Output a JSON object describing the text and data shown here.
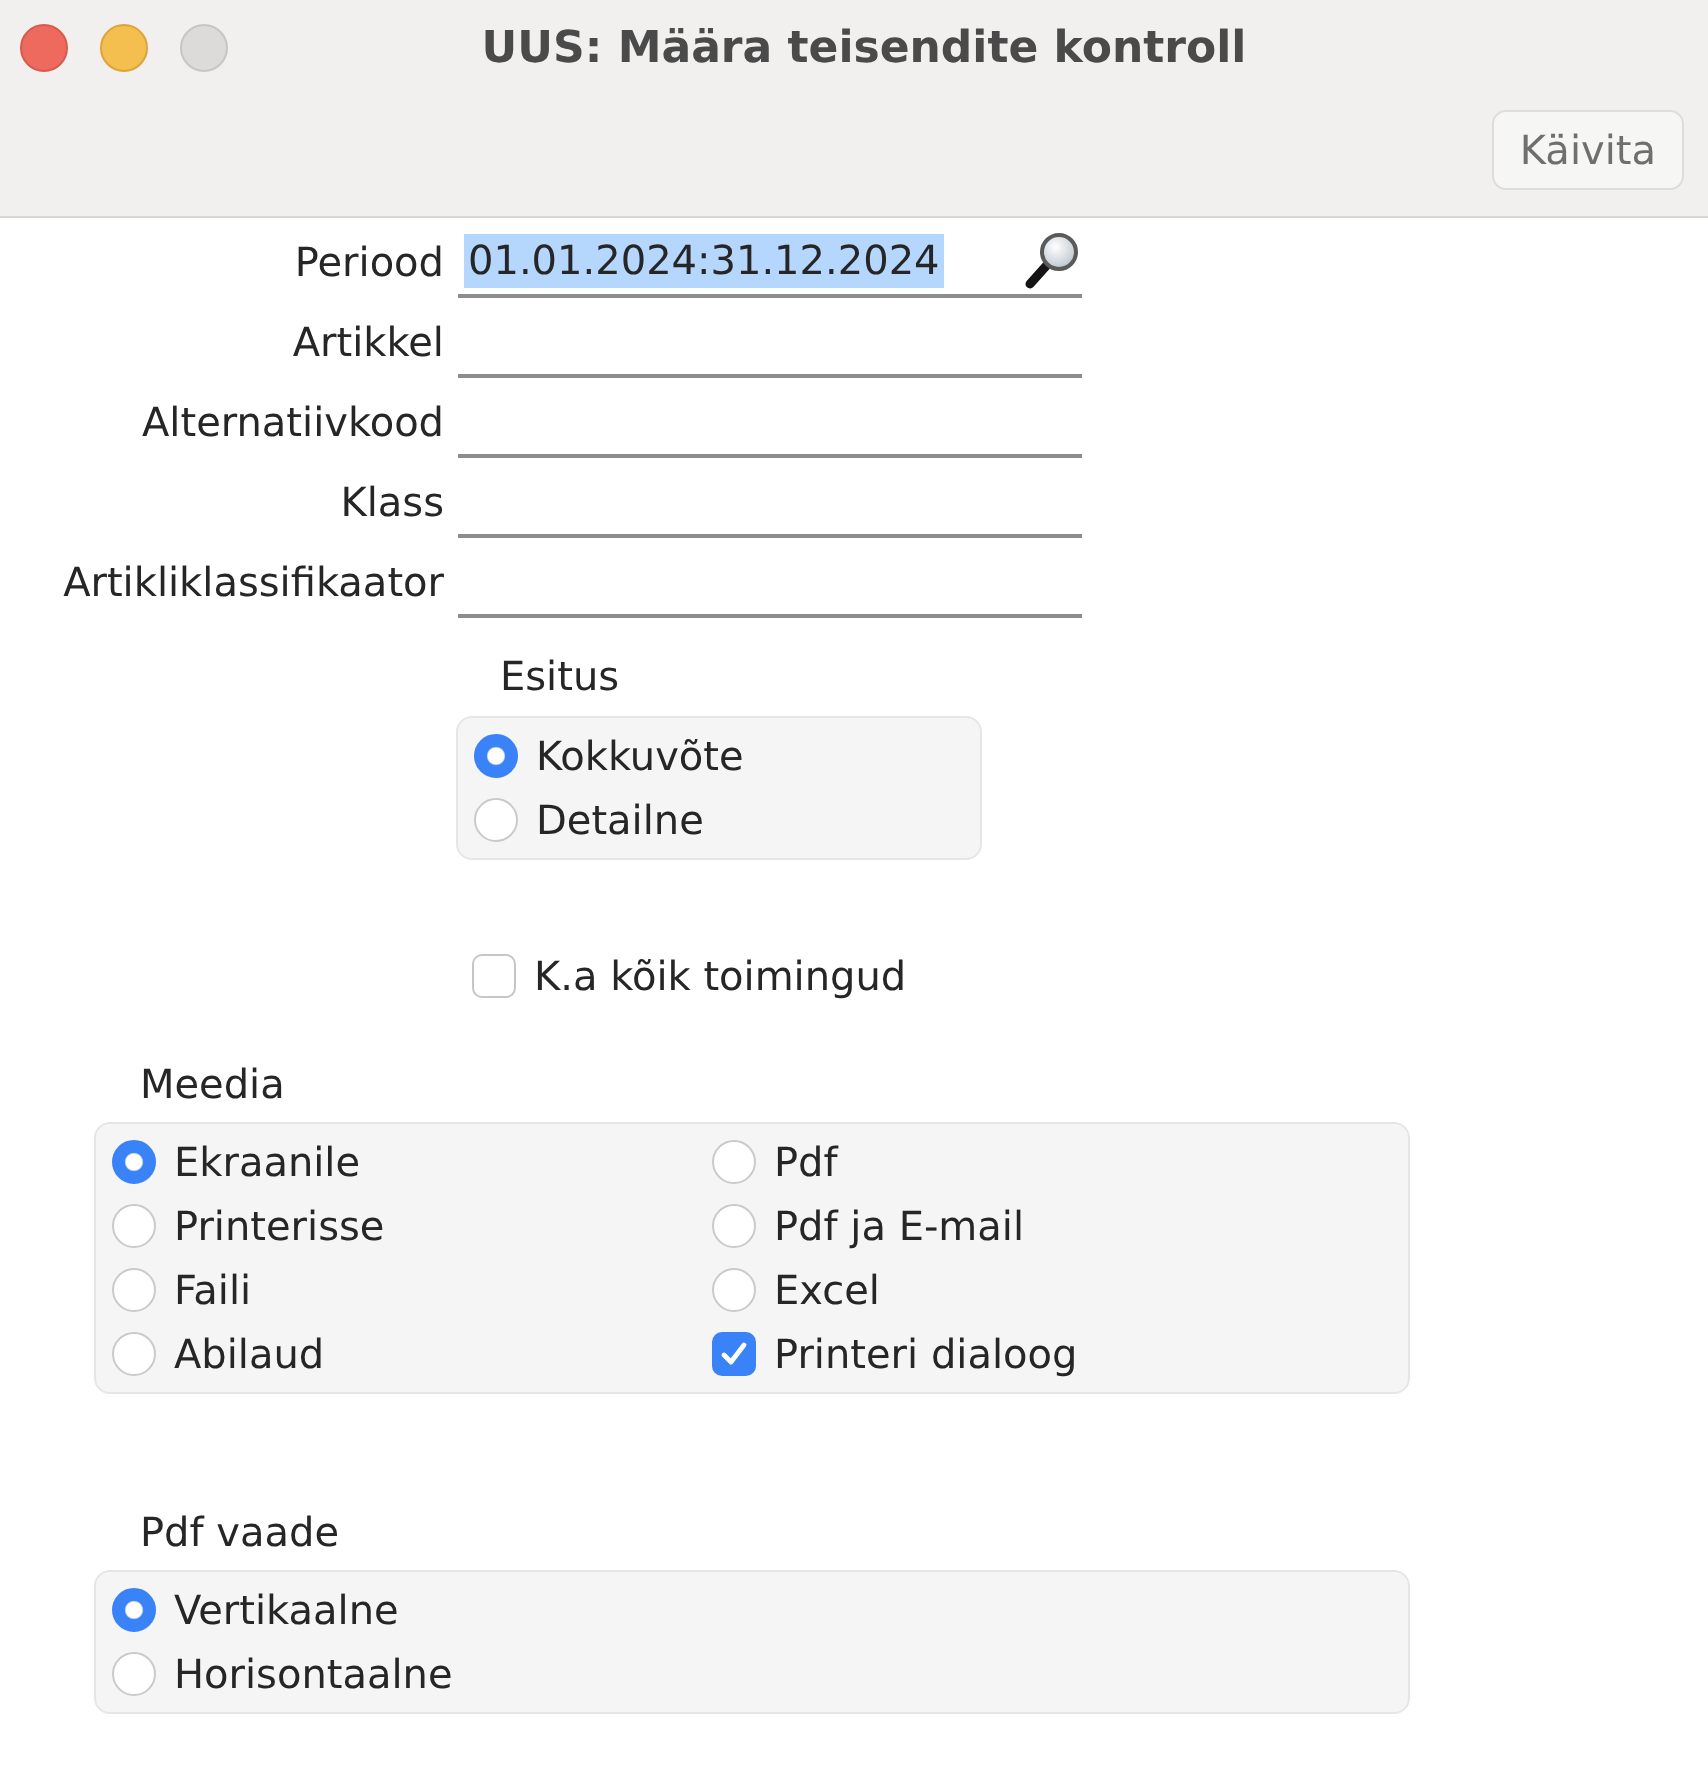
{
  "window": {
    "title": "UUS: Määra teisendite kontroll",
    "controls": [
      {
        "kind": "close",
        "disabled": false
      },
      {
        "kind": "minimize",
        "disabled": false
      },
      {
        "kind": "zoom",
        "disabled": true
      }
    ]
  },
  "toolbar": {
    "buttons": [
      {
        "label": "Käivita"
      }
    ]
  },
  "fields": [
    {
      "label": "Periood",
      "value": "01.01.2024:31.12.2024",
      "highlighted": true,
      "lookup": true
    },
    {
      "label": "Artikkel",
      "lookup": false
    },
    {
      "label": "Alternatiivkood",
      "lookup": false
    },
    {
      "label": "Klass",
      "lookup": false
    },
    {
      "label": "Artikliklassifikaator",
      "lookup": false
    }
  ],
  "presentation": {
    "title": "Esitus",
    "options": [
      {
        "label": "Kokkuvõte",
        "selected": true
      },
      {
        "label": "Detailne",
        "selected": false
      }
    ]
  },
  "include_all": {
    "label": "K.a kõik toimingud",
    "checked": false
  },
  "media": {
    "title": "Meedia",
    "columns": [
      [
        {
          "kind": "radio",
          "label": "Ekraanile",
          "selected": true
        },
        {
          "kind": "radio",
          "label": "Printerisse",
          "selected": false
        },
        {
          "kind": "radio",
          "label": "Faili",
          "selected": false
        },
        {
          "kind": "radio",
          "label": "Abilaud",
          "selected": false
        }
      ],
      [
        {
          "kind": "radio",
          "label": "Pdf",
          "selected": false
        },
        {
          "kind": "radio",
          "label": "Pdf ja E-mail",
          "selected": false
        },
        {
          "kind": "radio",
          "label": "Excel",
          "selected": false
        },
        {
          "kind": "checkbox",
          "label": "Printeri dialoog",
          "checked": true
        }
      ]
    ]
  },
  "pdf_view": {
    "title": "Pdf vaade",
    "options": [
      {
        "label": "Vertikaalne",
        "selected": true
      },
      {
        "label": "Horisontaalne",
        "selected": false
      }
    ]
  }
}
